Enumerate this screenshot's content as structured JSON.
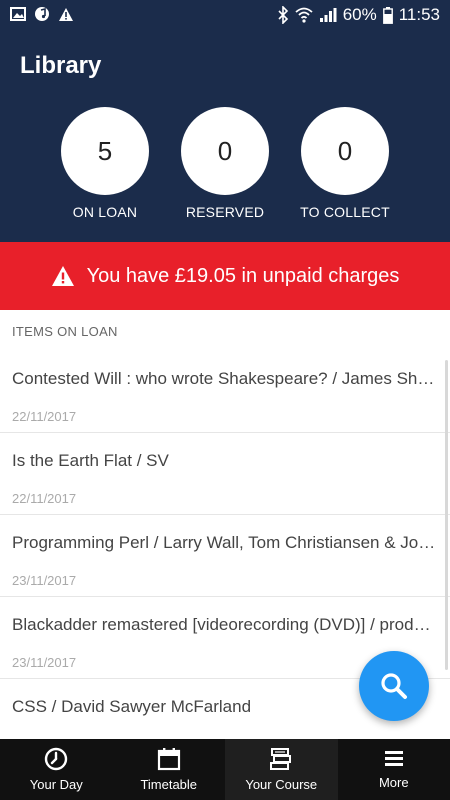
{
  "status_bar": {
    "battery": "60%",
    "time": "11:53"
  },
  "header": {
    "title": "Library"
  },
  "stats": [
    {
      "value": "5",
      "label": "ON LOAN"
    },
    {
      "value": "0",
      "label": "RESERVED"
    },
    {
      "value": "0",
      "label": "TO COLLECT"
    }
  ],
  "alert": {
    "text": "You have £19.05 in unpaid charges"
  },
  "section": {
    "title": "ITEMS ON LOAN"
  },
  "items": [
    {
      "title": "Contested Will : who wrote Shakespeare? / James Shapiro",
      "date": "22/11/2017"
    },
    {
      "title": "Is the Earth Flat / SV",
      "date": "22/11/2017"
    },
    {
      "title": "Programming Perl / Larry Wall, Tom Christiansen & Jon Orwant",
      "date": "23/11/2017"
    },
    {
      "title": "Blackadder remastered  [videorecording (DVD)] / produced by John Lloyd",
      "date": "23/11/2017"
    },
    {
      "title": "CSS / David Sawyer McFarland",
      "date": ""
    }
  ],
  "nav": [
    {
      "label": "Your Day",
      "icon": "clock-icon"
    },
    {
      "label": "Timetable",
      "icon": "calendar-icon"
    },
    {
      "label": "Your Course",
      "icon": "books-icon"
    },
    {
      "label": "More",
      "icon": "menu-icon"
    }
  ],
  "colors": {
    "header": "#1b2c4b",
    "alert": "#e8202a",
    "fab": "#2196f3",
    "nav": "#111111"
  }
}
